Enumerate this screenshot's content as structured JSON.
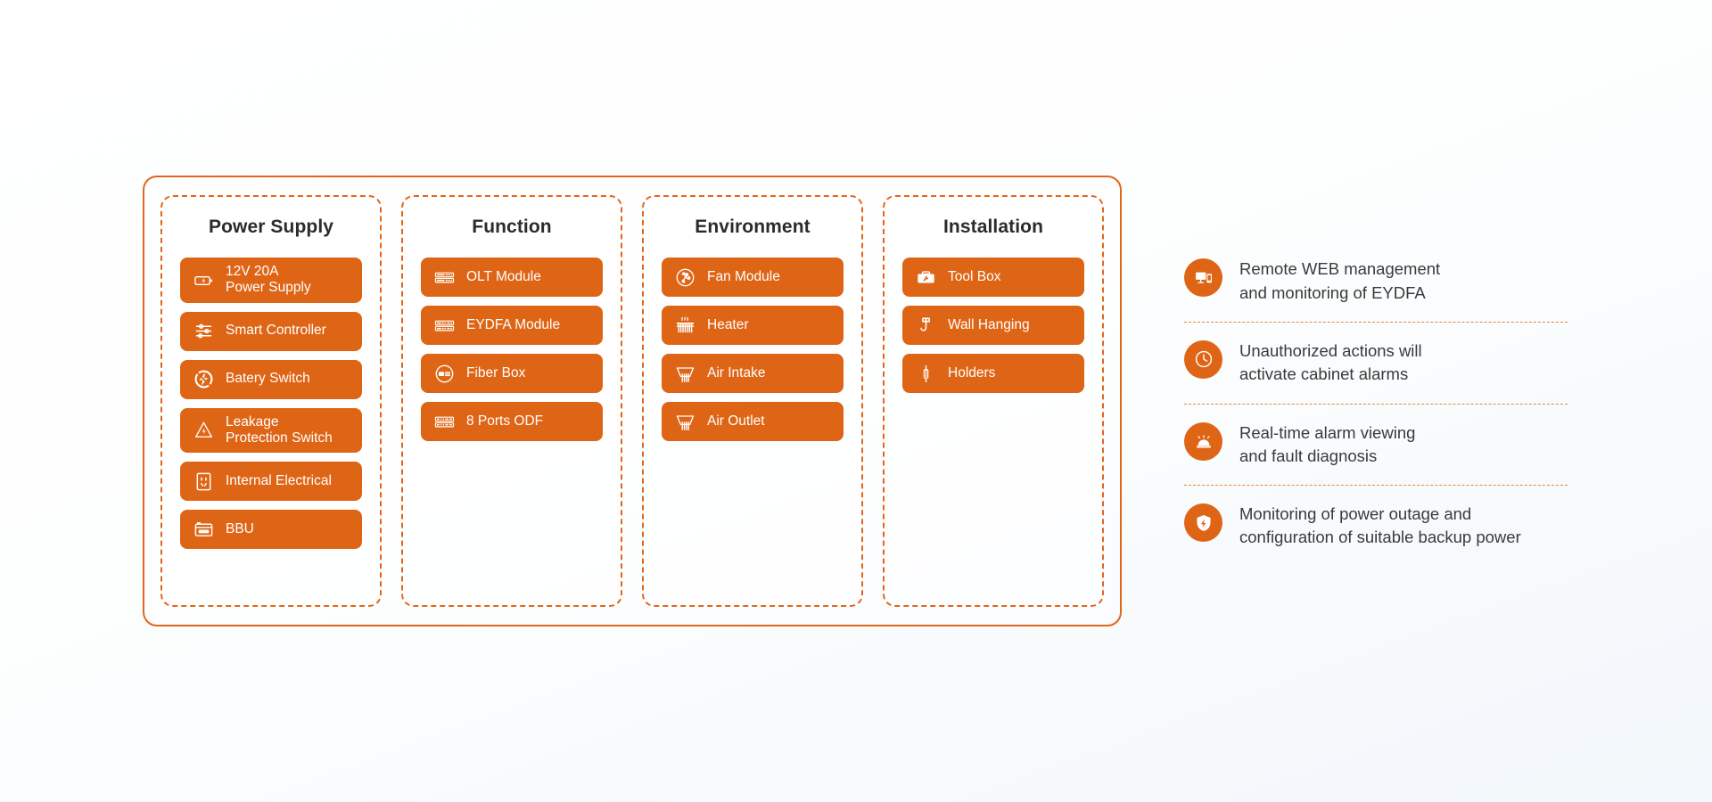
{
  "theme": {
    "accent": "#DF6516",
    "panel_border": "#E2661A",
    "dashed_border": "#E2661A",
    "text_dark": "#2b2b2b",
    "text_body": "#3a3a3a",
    "pill_text": "#ffffff",
    "background": "#f2f7fb"
  },
  "spec_panel": {
    "columns": [
      {
        "title": "Power Supply",
        "items": [
          {
            "label": "12V 20A\nPower Supply",
            "icon": "battery-icon"
          },
          {
            "label": "Smart Controller",
            "icon": "sliders-icon"
          },
          {
            "label": "Batery Switch",
            "icon": "power-bolt-icon"
          },
          {
            "label": "Leakage\nProtection Switch",
            "icon": "warning-bolt-icon"
          },
          {
            "label": "Internal Electrical",
            "icon": "power-outlet-icon"
          },
          {
            "label": "BBU",
            "icon": "bbu-unit-icon"
          }
        ]
      },
      {
        "title": "Function",
        "items": [
          {
            "label": "OLT Module",
            "icon": "olt-module-icon"
          },
          {
            "label": "EYDFA Module",
            "icon": "eydfa-module-icon"
          },
          {
            "label": "Fiber Box",
            "icon": "fiber-box-icon"
          },
          {
            "label": "8 Ports ODF",
            "icon": "odf-ports-icon"
          }
        ]
      },
      {
        "title": "Environment",
        "items": [
          {
            "label": "Fan Module",
            "icon": "fan-icon"
          },
          {
            "label": "Heater",
            "icon": "radiator-heater-icon"
          },
          {
            "label": "Air Intake",
            "icon": "air-intake-icon"
          },
          {
            "label": "Air Outlet",
            "icon": "air-outlet-icon"
          }
        ]
      },
      {
        "title": "Installation",
        "items": [
          {
            "label": "Tool Box",
            "icon": "toolbox-icon"
          },
          {
            "label": "Wall Hanging",
            "icon": "wall-hook-icon"
          },
          {
            "label": "Holders",
            "icon": "holder-icon"
          }
        ]
      }
    ]
  },
  "features": [
    {
      "text": "Remote WEB management\nand monitoring of EYDFA",
      "icon": "monitor-phone-icon"
    },
    {
      "text": "Unauthorized actions will\nactivate cabinet alarms",
      "icon": "clock-icon"
    },
    {
      "text": "Real-time alarm viewing\nand fault diagnosis",
      "icon": "alarm-bell-icon"
    },
    {
      "text": "Monitoring of power outage and\nconfiguration of suitable backup power",
      "icon": "shield-bolt-icon"
    }
  ]
}
